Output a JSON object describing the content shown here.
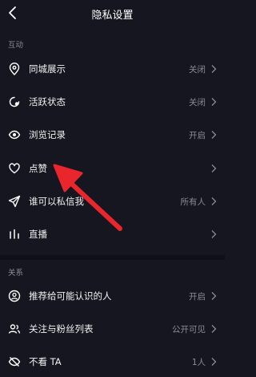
{
  "header": {
    "title": "隐私设置"
  },
  "sections": {
    "interaction": "互动",
    "relations": "关系"
  },
  "rows": {
    "same_city": {
      "label": "同城展示",
      "value": "关闭"
    },
    "active_status": {
      "label": "活跃状态",
      "value": "关闭"
    },
    "browse_history": {
      "label": "浏览记录",
      "value": "开启"
    },
    "likes": {
      "label": "点赞",
      "value": ""
    },
    "private_message": {
      "label": "谁可以私信我",
      "value": "所有人"
    },
    "live": {
      "label": "直播",
      "value": ""
    },
    "recommend": {
      "label": "推荐给可能认识的人",
      "value": "开启"
    },
    "follow_fans": {
      "label": "关注与粉丝列表",
      "value": "公开可见"
    },
    "hide_ta": {
      "label": "不看 TA",
      "value": "1人"
    }
  },
  "colors": {
    "background": "#15161f",
    "text": "#f2f2f2",
    "secondary": "#8b8c93",
    "annotation_arrow": "#e8262c"
  }
}
